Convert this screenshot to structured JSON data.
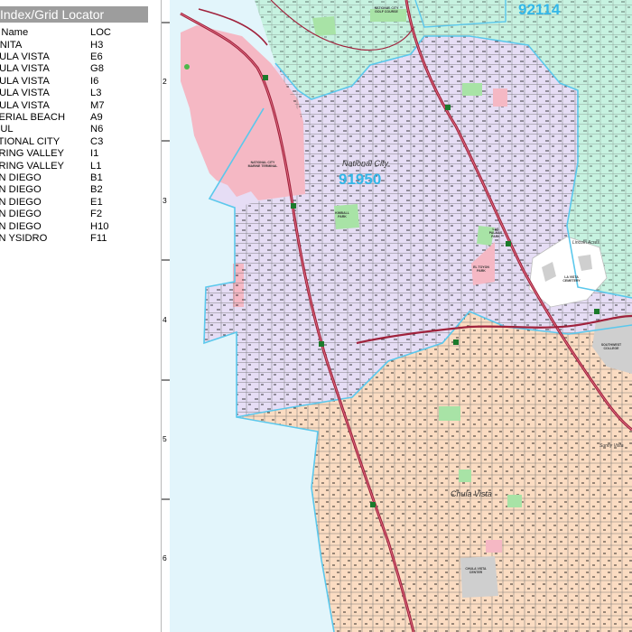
{
  "index": {
    "header": "Index/Grid Locator",
    "col_name": "P Name",
    "col_loc": "LOC",
    "rows": [
      {
        "name": "ONITA",
        "loc": "H3"
      },
      {
        "name": "HULA VISTA",
        "loc": "E6"
      },
      {
        "name": "HULA VISTA",
        "loc": "G8"
      },
      {
        "name": "HULA VISTA",
        "loc": "I6"
      },
      {
        "name": "HULA VISTA",
        "loc": "L3"
      },
      {
        "name": "HULA VISTA",
        "loc": "M7"
      },
      {
        "name": "PERIAL BEACH",
        "loc": "A9"
      },
      {
        "name": "MUL",
        "loc": "N6"
      },
      {
        "name": "ATIONAL CITY",
        "loc": "C3"
      },
      {
        "name": "PRING VALLEY",
        "loc": "I1"
      },
      {
        "name": "PRING VALLEY",
        "loc": "L1"
      },
      {
        "name": "AN DIEGO",
        "loc": "B1"
      },
      {
        "name": "AN DIEGO",
        "loc": "B2"
      },
      {
        "name": "AN DIEGO",
        "loc": "E1"
      },
      {
        "name": "AN DIEGO",
        "loc": "F2"
      },
      {
        "name": "AN DIEGO",
        "loc": "H10"
      },
      {
        "name": "AN YSIDRO",
        "loc": "F11"
      }
    ]
  },
  "grid_rows": [
    "2",
    "3",
    "4",
    "5",
    "6"
  ],
  "map": {
    "zip_labels": [
      "92114",
      "91950"
    ],
    "city_labels": [
      "National City",
      "Chula Vista",
      "Lincoln Acres",
      "Sunny Vista"
    ],
    "poi_labels": [
      "NATIONAL CITY GOLF COURSE",
      "KIMBALL PARK",
      "EL TOYON PARK",
      "LAS PALMAS PARK",
      "LA VISTA CEMETERY",
      "SOUTHWEST COLLEGE",
      "CHULA VISTA CENTER",
      "NATIONAL CITY MARINE TERMINAL"
    ],
    "colors": {
      "water": "#e2f5fb",
      "national_city": "#e6ddf5",
      "chula_vista": "#fbdcc2",
      "san_diego": "#c6f2e0",
      "port": "#f5b8c4",
      "park": "#a8e3a6",
      "boundary": "#5bc8ec",
      "freeway": "#a0223c"
    }
  }
}
